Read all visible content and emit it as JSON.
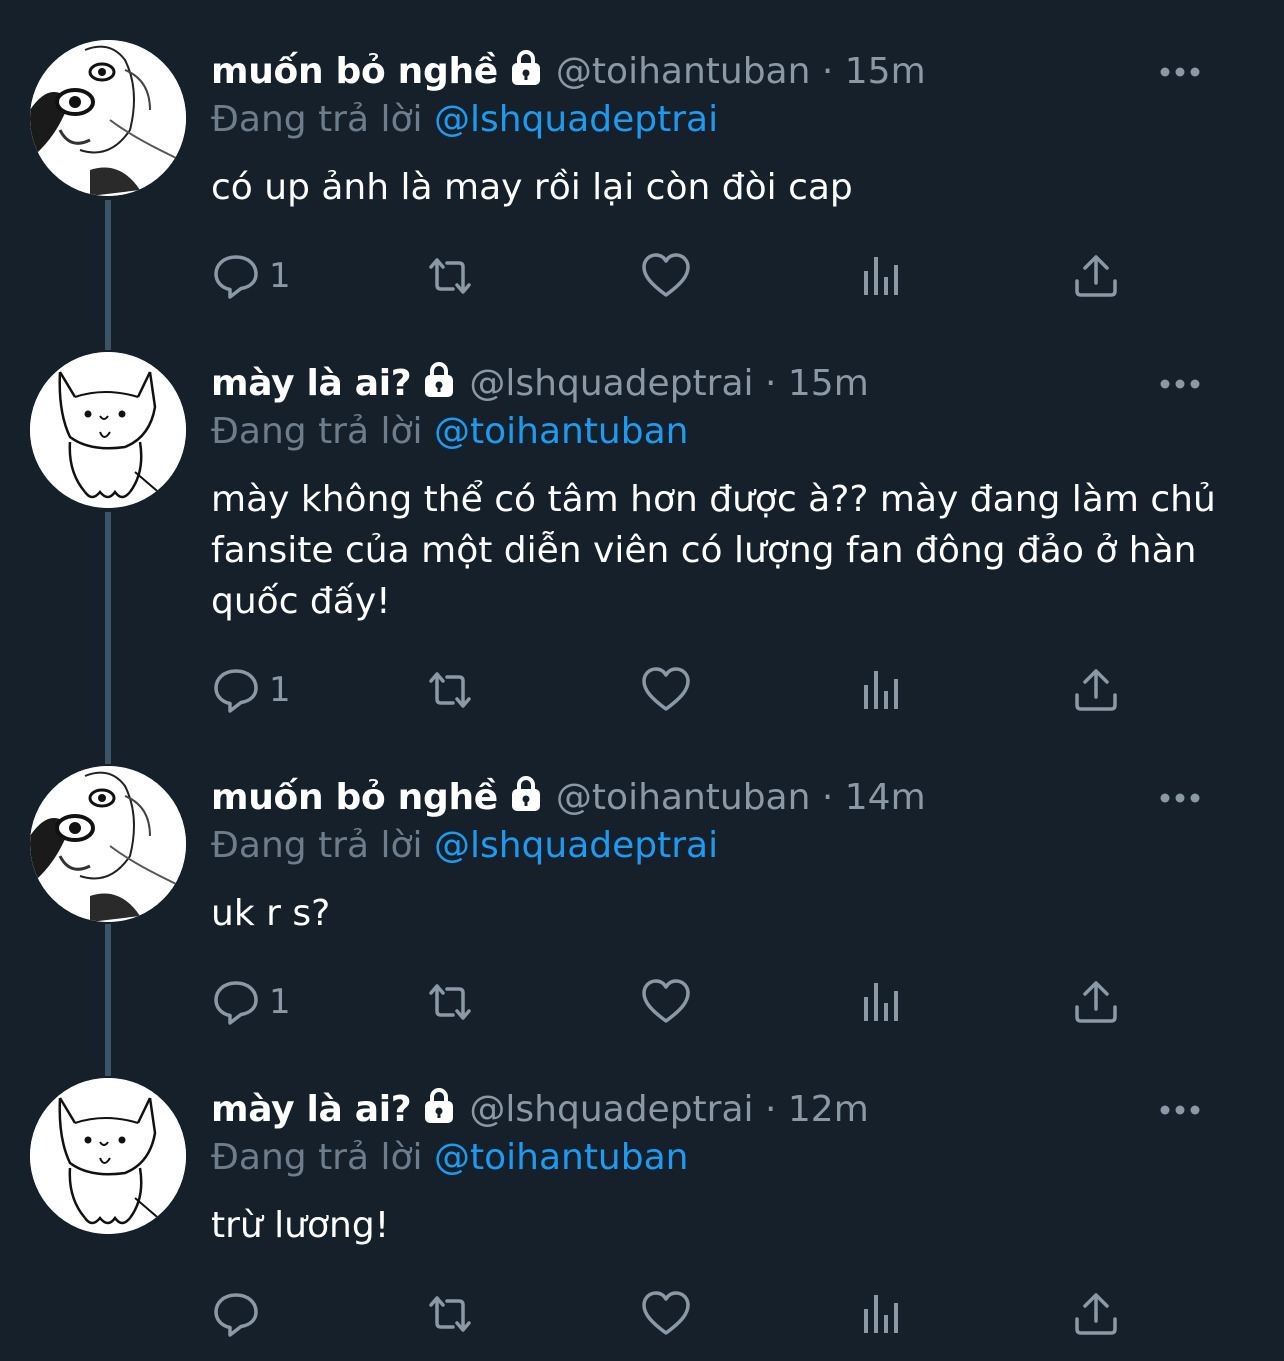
{
  "tweets": [
    {
      "display_name": "muốn bỏ nghề",
      "handle": "@toihantuban",
      "separator": "·",
      "time": "15m",
      "reply_label": "Đang trả lời",
      "reply_mention": "@lshquadeptrai",
      "text": "có up ảnh là may rồi lại còn đòi cap",
      "reply_count": "1",
      "avatar": "sketch-face-avatar"
    },
    {
      "display_name": "mày là ai?",
      "handle": "@lshquadeptrai",
      "separator": "·",
      "time": "15m",
      "reply_label": "Đang trả lời",
      "reply_mention": "@toihantuban",
      "text": "mày không thể có tâm hơn được à?? mày đang làm chủ fansite của một diễn viên có lượng fan đông đảo ở hàn quốc đấy!",
      "reply_count": "1",
      "avatar": "sketch-cat-avatar"
    },
    {
      "display_name": "muốn bỏ nghề",
      "handle": "@toihantuban",
      "separator": "·",
      "time": "14m",
      "reply_label": "Đang trả lời",
      "reply_mention": "@lshquadeptrai",
      "text": "uk r s?",
      "reply_count": "1",
      "avatar": "sketch-face-avatar"
    },
    {
      "display_name": "mày là ai?",
      "handle": "@lshquadeptrai",
      "separator": "·",
      "time": "12m",
      "reply_label": "Đang trả lời",
      "reply_mention": "@toihantuban",
      "text": "trừ lương!",
      "reply_count": "",
      "avatar": "sketch-cat-avatar"
    }
  ],
  "icons": {
    "protected": "lock-icon",
    "more": "more-horizontal-icon",
    "reply": "reply-icon",
    "retweet": "retweet-icon",
    "like": "heart-icon",
    "views": "analytics-icon",
    "share": "share-icon"
  },
  "colors": {
    "background": "#15202b",
    "text_primary": "#ffffff",
    "text_secondary": "#8b98a5",
    "mention": "#1d9bf0",
    "thread_line": "#3d5466"
  }
}
